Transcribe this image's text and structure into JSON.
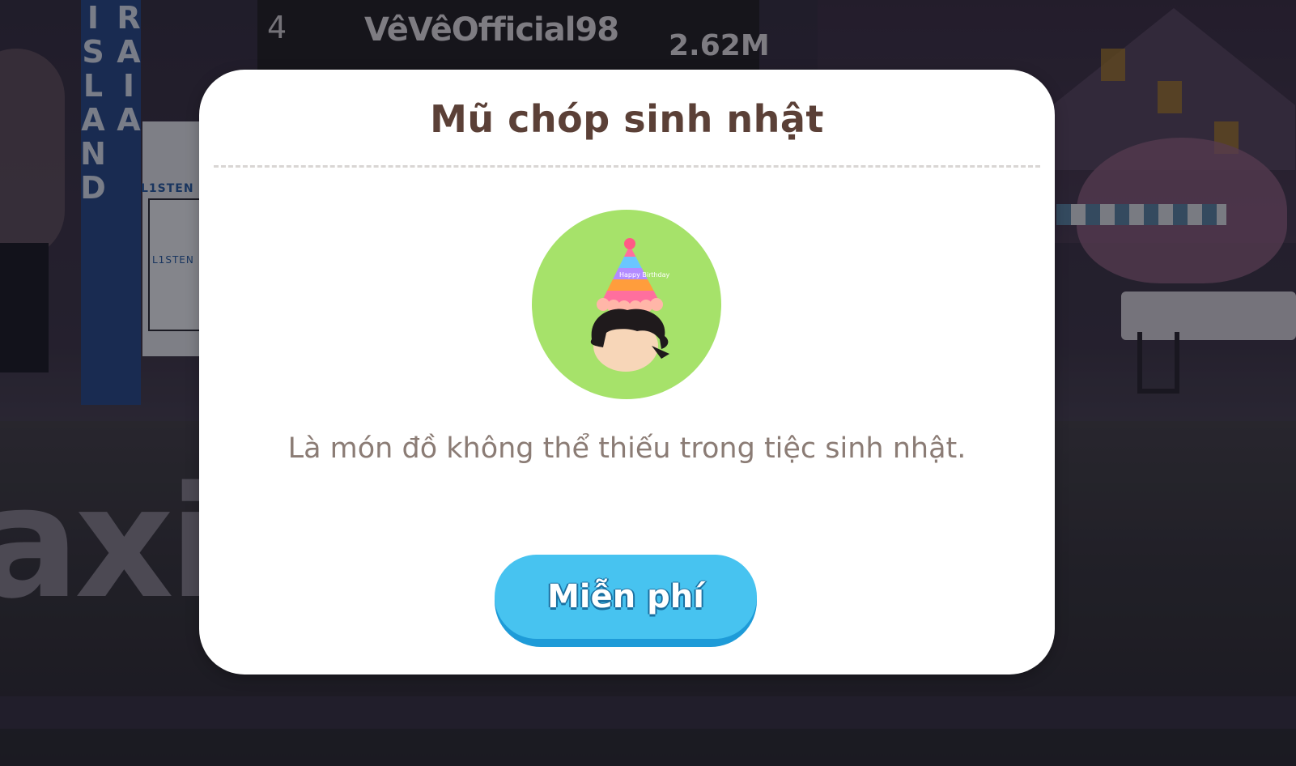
{
  "background": {
    "leaderboard": {
      "rank": "4",
      "player_name": "VêVêOfficial98",
      "score": "2.62M"
    },
    "banner_text": "RAIA ISLAND",
    "sign_text_1": "L1STEN",
    "sign_text_2": "L1STEN",
    "big_sign_text": "axi"
  },
  "modal": {
    "title": "Mũ chóp sinh nhật",
    "item_icon": "birthday-party-hat-avatar",
    "item_hat_text": "Happy Birthday",
    "description": "Là món đồ không thể thiếu trong tiệc sinh nhật.",
    "button_label": "Miễn phí"
  },
  "colors": {
    "title": "#5b4037",
    "description": "#8b7c75",
    "icon_bg": "#a6e26a",
    "button": "#47c3f0",
    "button_shadow": "#1e9bd8"
  }
}
